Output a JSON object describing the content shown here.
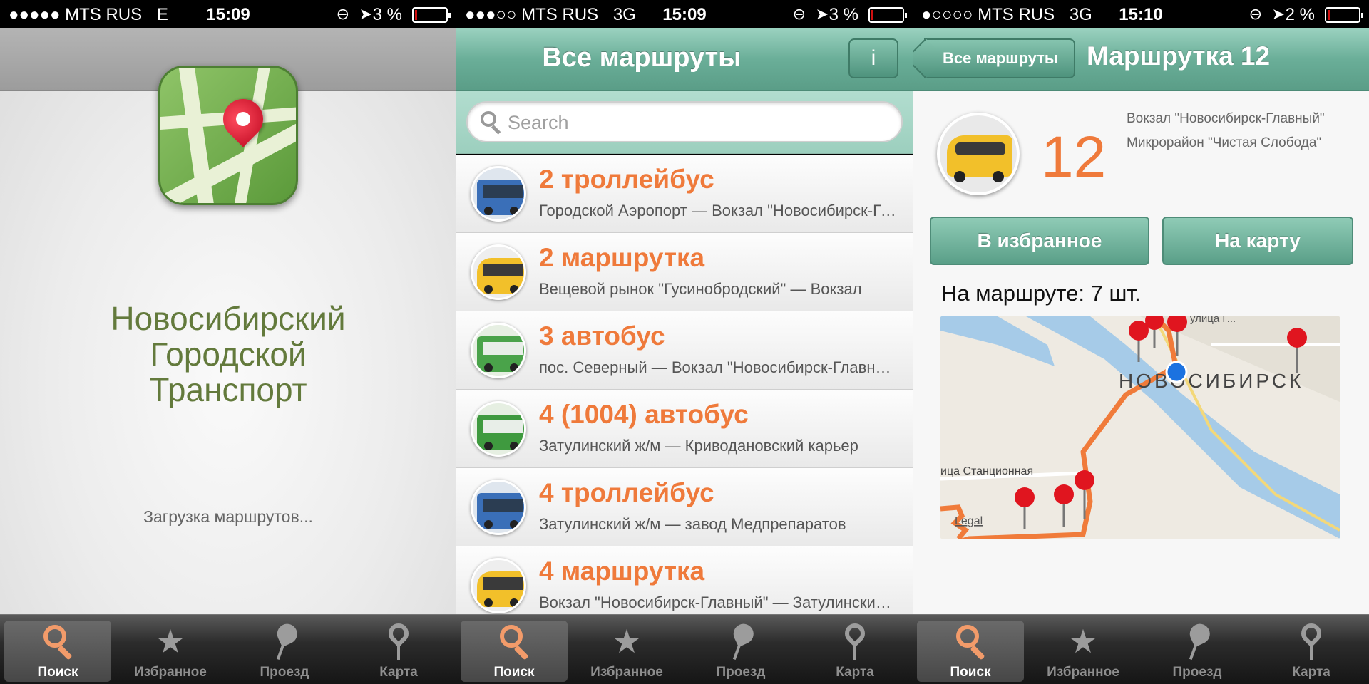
{
  "status_bars": [
    {
      "carrier": "●●●●● MTS RUS",
      "network": "E",
      "time": "15:09",
      "battery": "3 %"
    },
    {
      "carrier": "●●●○○ MTS RUS",
      "network": "3G",
      "time": "15:09",
      "battery": "3 %"
    },
    {
      "carrier": "●○○○○ MTS RUS",
      "network": "3G",
      "time": "15:10",
      "battery": "2 %"
    }
  ],
  "splash": {
    "title_lines": [
      "Новосибирский",
      "Городской",
      "Транспорт"
    ],
    "loading": "Загрузка маршрутов..."
  },
  "list": {
    "title": "Все маршруты",
    "info_label": "i",
    "search_placeholder": "Search",
    "routes": [
      {
        "name": "2 троллейбус",
        "sub": "Городской Аэропорт — Вокзал \"Новосибирск-Главный\"",
        "vehicle": "trolleybus"
      },
      {
        "name": "2 маршрутка",
        "sub": "Вещевой рынок \"Гусинобродский\" — Вокзал",
        "vehicle": "minibus"
      },
      {
        "name": "3 автобус",
        "sub": "пос. Северный — Вокзал \"Новосибирск-Главный\"",
        "vehicle": "bus"
      },
      {
        "name": "4 (1004) автобус",
        "sub": "Затулинский ж/м — Криводановский карьер",
        "vehicle": "bus"
      },
      {
        "name": "4 троллейбус",
        "sub": "Затулинский ж/м — завод Медпрепаратов",
        "vehicle": "trolleybus"
      },
      {
        "name": "4 маршрутка",
        "sub": "Вокзал \"Новосибирск-Главный\" — Затулинский ж/м",
        "vehicle": "minibus"
      }
    ]
  },
  "detail": {
    "back_label": "Все маршруты",
    "title": "Маршрутка 12",
    "number": "12",
    "stop_a": "Вокзал \"Новосибирск-Главный\"",
    "stop_b": "Микрорайон \"Чистая Слобода\"",
    "favorite_button": "В избранное",
    "map_button": "На карту",
    "on_route": "На маршруте: 7 шт.",
    "map": {
      "city_label": "НОВОСИБИРСК",
      "street_label_1": "ица Станционная",
      "street_label_2": "улица Г...",
      "legal": "Legal"
    }
  },
  "tabs": [
    {
      "label": "Поиск",
      "icon": "search-icon"
    },
    {
      "label": "Избранное",
      "icon": "star-icon"
    },
    {
      "label": "Проезд",
      "icon": "pin-icon"
    },
    {
      "label": "Карта",
      "icon": "map-pin-icon"
    }
  ],
  "colors": {
    "accent_green": "#6aae98",
    "route_orange": "#ef7a3b",
    "splash_title": "#637a3c"
  }
}
